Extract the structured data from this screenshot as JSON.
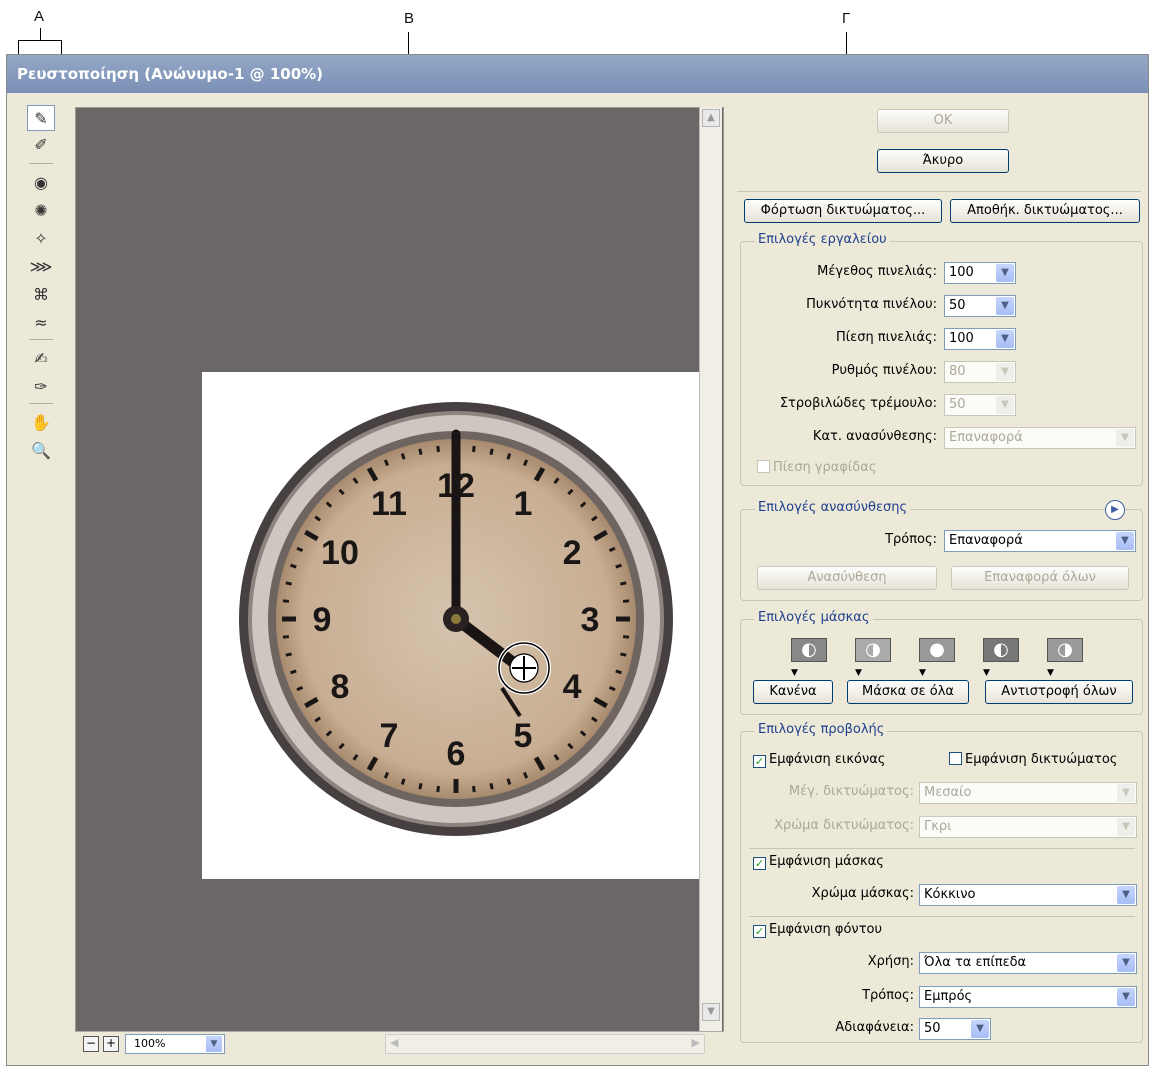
{
  "callouts": {
    "a": "A",
    "b": "B",
    "c": "Γ"
  },
  "window": {
    "title": "Ρευστοποίηση (Ανώνυμο-1 @ 100%)"
  },
  "tools": [
    {
      "name": "forward-warp-tool-icon",
      "glyph": "✎"
    },
    {
      "name": "reconstruct-tool-icon",
      "glyph": "✐"
    },
    {
      "name": "twirl-tool-icon",
      "glyph": "◉"
    },
    {
      "name": "pucker-tool-icon",
      "glyph": "✺"
    },
    {
      "name": "bloat-tool-icon",
      "glyph": "✧"
    },
    {
      "name": "push-left-tool-icon",
      "glyph": "⋙"
    },
    {
      "name": "mirror-tool-icon",
      "glyph": "⌘"
    },
    {
      "name": "turbulence-tool-icon",
      "glyph": "≈"
    },
    {
      "name": "freeze-mask-tool-icon",
      "glyph": "✍"
    },
    {
      "name": "thaw-mask-tool-icon",
      "glyph": "✑"
    },
    {
      "name": "hand-tool-icon",
      "glyph": "✋"
    },
    {
      "name": "zoom-tool-icon",
      "glyph": "🔍"
    }
  ],
  "statusbar": {
    "zoom": "100%"
  },
  "buttons": {
    "ok": "OK",
    "cancel": "Άκυρο",
    "load_mesh": "Φόρτωση δικτυώματος...",
    "save_mesh": "Αποθήκ. δικτυώματος..."
  },
  "tool_options": {
    "title": "Επιλογές εργαλείου",
    "brush_size": {
      "label": "Μέγεθος πινελιάς:",
      "value": "100"
    },
    "brush_density": {
      "label": "Πυκνότητα πινέλου:",
      "value": "50"
    },
    "brush_pressure": {
      "label": "Πίεση πινελιάς:",
      "value": "100"
    },
    "brush_rate": {
      "label": "Ρυθμός πινέλου:",
      "value": "80"
    },
    "turbulent_jitter": {
      "label": "Στροβιλώδες τρέμουλο:",
      "value": "50"
    },
    "reconstruct_mode": {
      "label": "Κατ. ανασύνθεσης:",
      "value": "Επαναφορά"
    },
    "stylus_pressure": "Πίεση γραφίδας"
  },
  "reconstruct_options": {
    "title": "Επιλογές ανασύνθεσης",
    "mode": {
      "label": "Τρόπος:",
      "value": "Επαναφορά"
    },
    "reconstruct": "Ανασύνθεση",
    "restore_all": "Επαναφορά όλων"
  },
  "mask_options": {
    "title": "Επιλογές μάσκας",
    "none": "Κανένα",
    "mask_all": "Μάσκα σε όλα",
    "invert_all": "Αντιστροφή όλων"
  },
  "view_options": {
    "title": "Επιλογές προβολής",
    "show_image": "Εμφάνιση εικόνας",
    "show_mesh": "Εμφάνιση δικτυώματος",
    "mesh_size": {
      "label": "Μέγ. δικτυώματος:",
      "value": "Μεσαίο"
    },
    "mesh_color": {
      "label": "Χρώμα δικτυώματος:",
      "value": "Γκρι"
    },
    "show_mask": "Εμφάνιση μάσκας",
    "mask_color": {
      "label": "Χρώμα μάσκας:",
      "value": "Κόκκινο"
    },
    "show_backdrop": "Εμφάνιση φόντου",
    "use": {
      "label": "Χρήση:",
      "value": "Όλα τα επίπεδα"
    },
    "mode": {
      "label": "Τρόπος:",
      "value": "Εμπρός"
    },
    "opacity": {
      "label": "Αδιαφάνεια:",
      "value": "50"
    }
  },
  "clock": {
    "numbers": [
      "12",
      "1",
      "2",
      "3",
      "4",
      "5",
      "6",
      "7",
      "8",
      "9",
      "10",
      "11"
    ]
  }
}
